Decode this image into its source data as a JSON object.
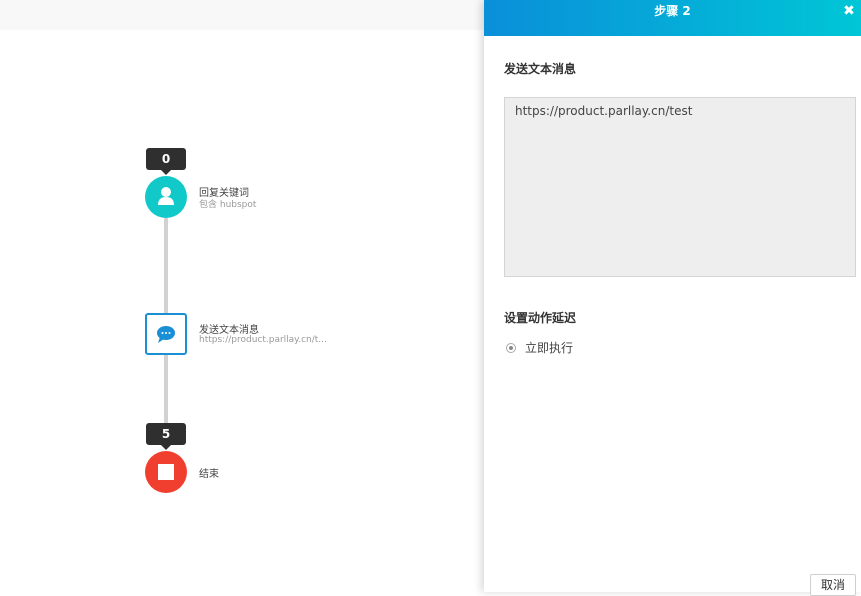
{
  "flow": {
    "nodes": [
      {
        "badge": "0",
        "title": "回复关键词",
        "subtitle": "包含 hubspot",
        "icon": "user-icon",
        "color": "#12c9c9"
      },
      {
        "badge": "",
        "title": "发送文本消息",
        "subtitle": "https://product.parllay.cn/t...",
        "icon": "chat-bubble-icon",
        "color": "#1a8fd6"
      },
      {
        "badge": "5",
        "title": "结束",
        "subtitle": "",
        "icon": "stop-icon",
        "color": "#f03e2f"
      }
    ]
  },
  "panel": {
    "title": "步骤 2",
    "close_icon": "close-icon",
    "message_section_title": "发送文本消息",
    "message_text": "https://product.parllay.cn/test",
    "delay_section_title": "设置动作延迟",
    "delay_option_label": "立即执行",
    "cancel_label": "取消",
    "header_gradient": [
      "#0a8fd9",
      "#00c6d6"
    ]
  }
}
